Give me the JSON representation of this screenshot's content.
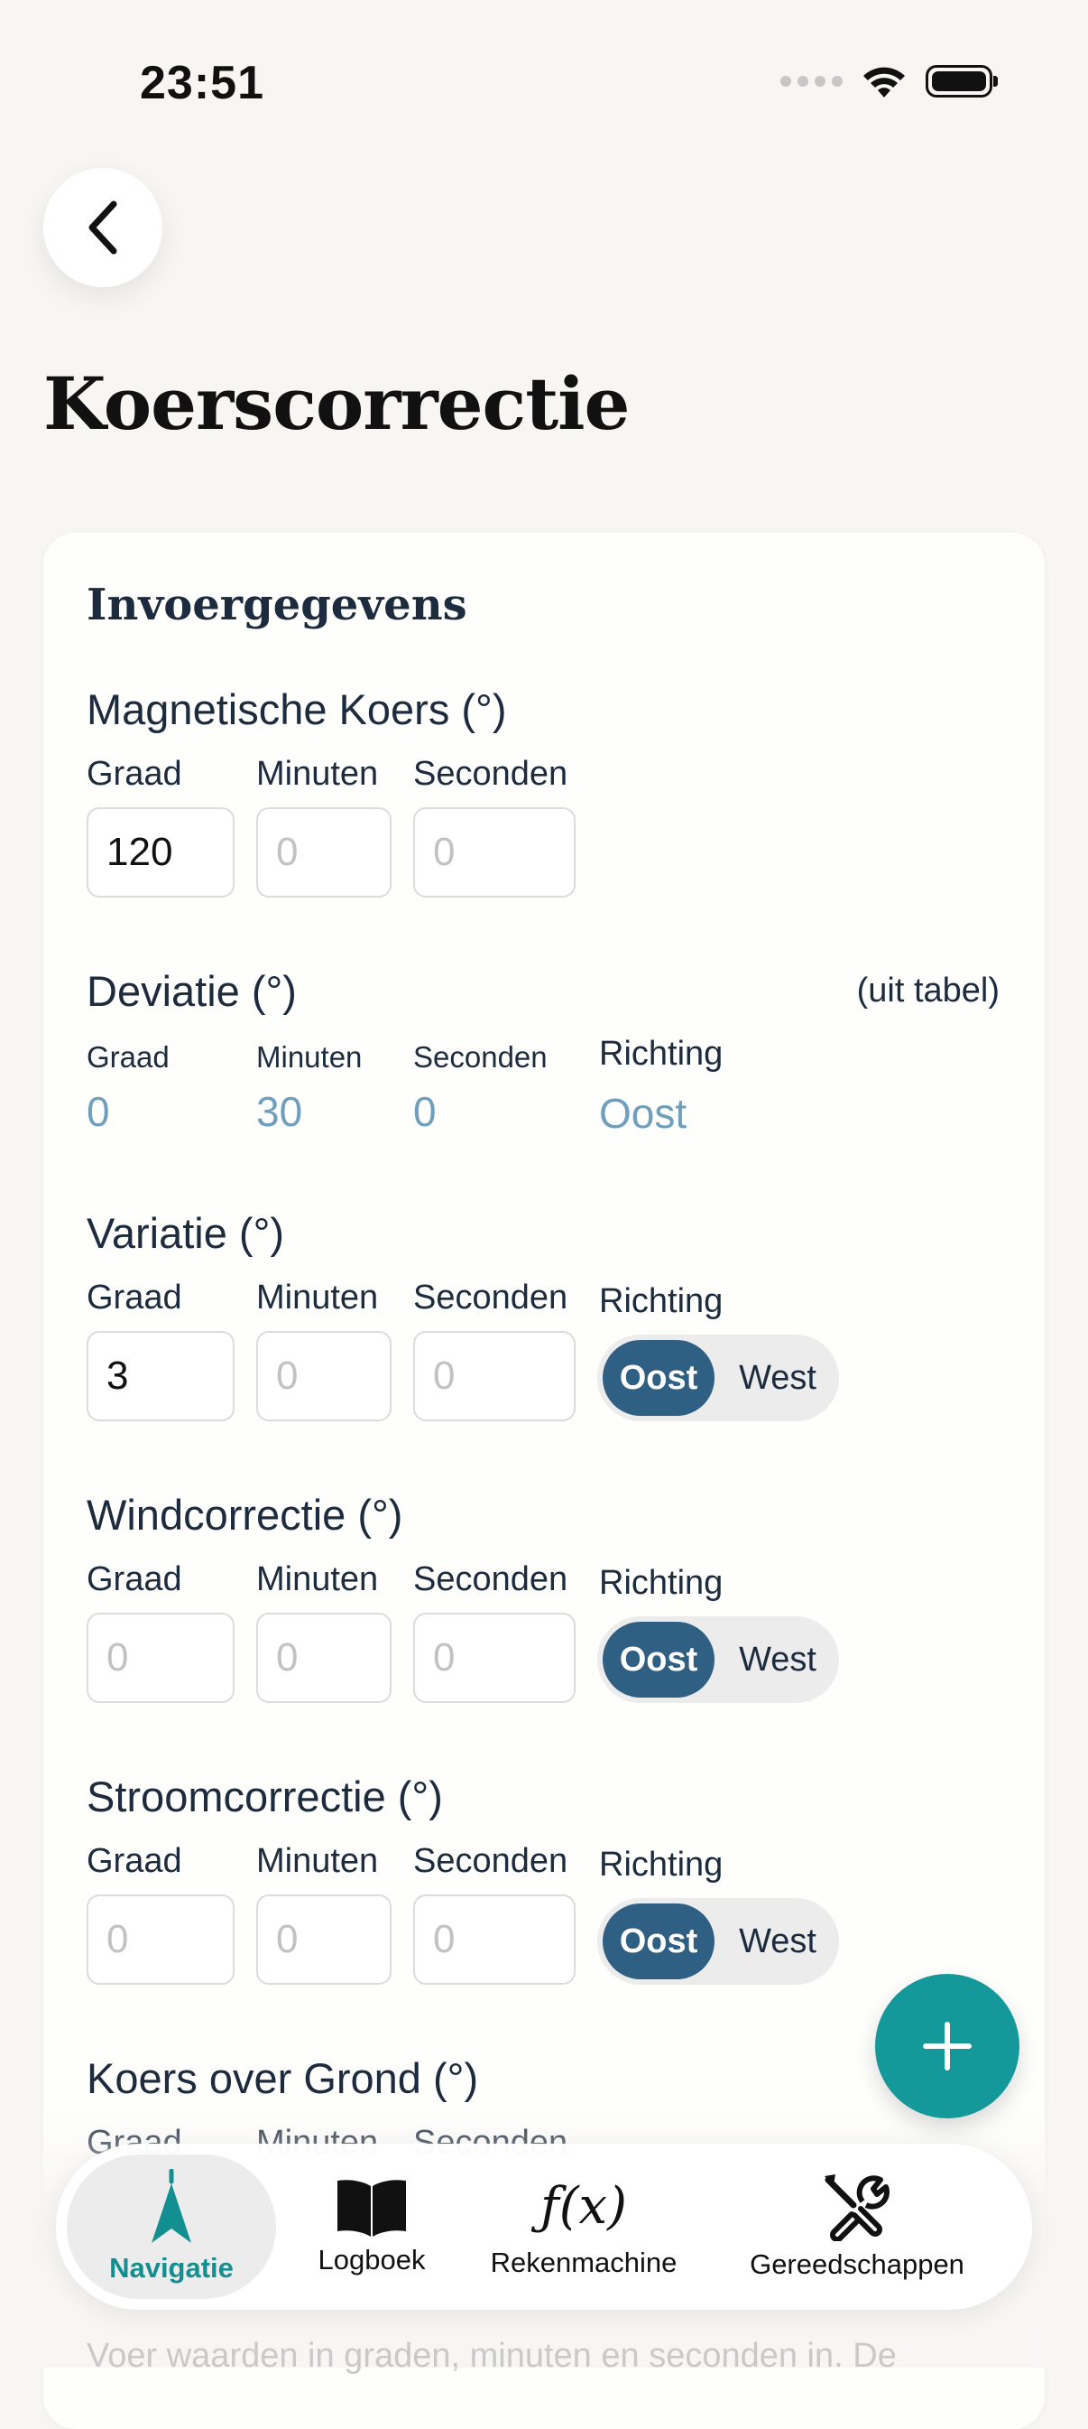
{
  "status_bar": {
    "time": "23:51",
    "icons": [
      "signal-icon",
      "wifi-icon",
      "battery-icon"
    ]
  },
  "header": {
    "back_icon": "chevron-left-icon",
    "title": "Koerscorrectie"
  },
  "card": {
    "title": "Invoergegevens"
  },
  "labels": {
    "graad": "Graad",
    "minuten": "Minuten",
    "seconden": "Seconden",
    "richting": "Richting",
    "placeholder_zero": "0"
  },
  "sections": {
    "magnetische_koers": {
      "title": "Magnetische Koers (°)",
      "graad": "120",
      "minuten": "",
      "seconden": ""
    },
    "deviatie": {
      "title": "Deviatie (°)",
      "note": "(uit tabel)",
      "graad": "0",
      "minuten": "30",
      "seconden": "0",
      "richting": "Oost"
    },
    "variatie": {
      "title": "Variatie (°)",
      "graad": "3",
      "minuten": "",
      "seconden": "",
      "toggle": {
        "options": [
          "Oost",
          "West"
        ],
        "selected": "Oost"
      }
    },
    "windcorrectie": {
      "title": "Windcorrectie (°)",
      "graad": "",
      "minuten": "",
      "seconden": "",
      "toggle": {
        "options": [
          "Oost",
          "West"
        ],
        "selected": "Oost"
      }
    },
    "stroomcorrectie": {
      "title": "Stroomcorrectie (°)",
      "graad": "",
      "minuten": "",
      "seconden": "",
      "toggle": {
        "options": [
          "Oost",
          "West"
        ],
        "selected": "Oost"
      }
    },
    "koers_over_grond": {
      "title": "Koers over Grond (°)"
    }
  },
  "hint": "Voer waarden in graden, minuten en seconden in. De",
  "fab": {
    "icon": "plus-icon"
  },
  "bottom_nav": {
    "items": [
      {
        "label": "Navigatie",
        "icon": "navigation-arrow-icon",
        "active": true
      },
      {
        "label": "Logboek",
        "icon": "book-icon",
        "active": false
      },
      {
        "label": "Rekenmachine",
        "icon": "function-icon",
        "active": false
      },
      {
        "label": "Gereedschappen",
        "icon": "tools-icon",
        "active": false
      }
    ],
    "function_glyph": "ƒ(x)"
  },
  "colors": {
    "accent_teal": "#14989a",
    "toggle_active": "#2f5f82",
    "static_value": "#6f9fbd",
    "background": "#f7f6f3"
  }
}
